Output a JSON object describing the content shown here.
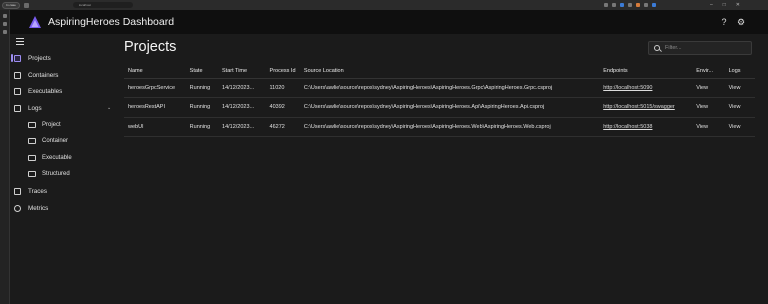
{
  "browser": {
    "profile_label": "In case",
    "address": "localhost"
  },
  "header": {
    "title": "AspiringHeroes Dashboard",
    "help_icon": "help-circle-icon",
    "settings_icon": "gear-icon"
  },
  "sidebar": {
    "items": [
      {
        "label": "Projects",
        "icon": "projects-icon"
      },
      {
        "label": "Containers",
        "icon": "containers-icon"
      },
      {
        "label": "Executables",
        "icon": "executables-icon"
      },
      {
        "label": "Logs",
        "icon": "logs-icon"
      },
      {
        "label": "Traces",
        "icon": "traces-icon"
      },
      {
        "label": "Metrics",
        "icon": "metrics-icon"
      }
    ],
    "log_subitems": [
      {
        "label": "Project"
      },
      {
        "label": "Container"
      },
      {
        "label": "Executable"
      },
      {
        "label": "Structured"
      }
    ]
  },
  "main": {
    "title": "Projects",
    "filter_placeholder": "Filter...",
    "columns": [
      "Name",
      "State",
      "Start Time",
      "Process Id",
      "Source Location",
      "Endpoints",
      "Envir...",
      "Logs"
    ],
    "rows": [
      {
        "name": "heroesGrpcService",
        "state": "Running",
        "start": "14/12/2023...",
        "pid": "11020",
        "source": "C:\\Users\\awlie\\source\\repos\\sydney\\AspiringHeroes\\AspiringHeroes.Grpc\\AspiringHeroes.Grpc.csproj",
        "endpoint": "http://localhost:5090",
        "env": "View",
        "logs": "View"
      },
      {
        "name": "heroesRestAPI",
        "state": "Running",
        "start": "14/12/2023...",
        "pid": "40392",
        "source": "C:\\Users\\awlie\\source\\repos\\sydney\\AspiringHeroes\\AspiringHeroes.Api\\AspiringHeroes.Api.csproj",
        "endpoint": "http://localhost:5015/swagger",
        "env": "View",
        "logs": "View"
      },
      {
        "name": "webUI",
        "state": "Running",
        "start": "14/12/2023...",
        "pid": "46272",
        "source": "C:\\Users\\awlie\\source\\repos\\sydney\\AspiringHeroes\\AspiringHeroes.Web\\AspiringHeroes.Web.csproj",
        "endpoint": "http://localhost:5038",
        "env": "View",
        "logs": "View"
      }
    ]
  },
  "colors": {
    "accent": "#9d8df2",
    "header_bg": "#0f0f0f",
    "page_bg": "#1b1b1b"
  }
}
